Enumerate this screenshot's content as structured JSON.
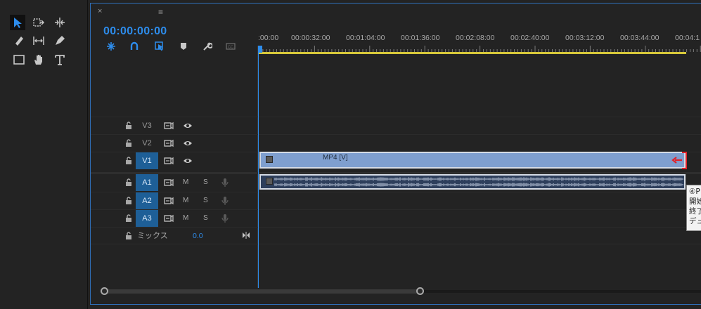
{
  "timeline": {
    "close_glyph": "×",
    "menu_glyph": "≡",
    "timecode": "00:00:00:00",
    "ruler_labels": [
      ":00:00",
      "00:00:32:00",
      "00:01:04:00",
      "00:01:36:00",
      "00:02:08:00",
      "00:02:40:00",
      "00:03:12:00",
      "00:03:44:00",
      "00:04:1"
    ]
  },
  "tracks": [
    {
      "name": "V3",
      "kind": "video",
      "selected": false
    },
    {
      "name": "V2",
      "kind": "video",
      "selected": false
    },
    {
      "name": "V1",
      "kind": "video",
      "selected": true
    },
    {
      "name": "A1",
      "kind": "audio",
      "selected": true,
      "m": "M",
      "s": "S"
    },
    {
      "name": "A2",
      "kind": "audio",
      "selected": true,
      "m": "M",
      "s": "S"
    },
    {
      "name": "A3",
      "kind": "audio",
      "selected": true,
      "m": "M",
      "s": "S"
    }
  ],
  "mix": {
    "label": "ミックス",
    "value": "0.0"
  },
  "clips": {
    "video_label": "MP4 [V]"
  },
  "tooltip": {
    "lines": [
      "④P",
      "開始",
      "終了",
      "デュ"
    ]
  },
  "colors": {
    "accent": "#2d8ceb",
    "track_selected": "#1e5f97",
    "video_clip": "#7f9fcf",
    "audio_clip": "#2e3f5c",
    "work_area": "#d7c83a",
    "annotation": "#e0222a"
  }
}
